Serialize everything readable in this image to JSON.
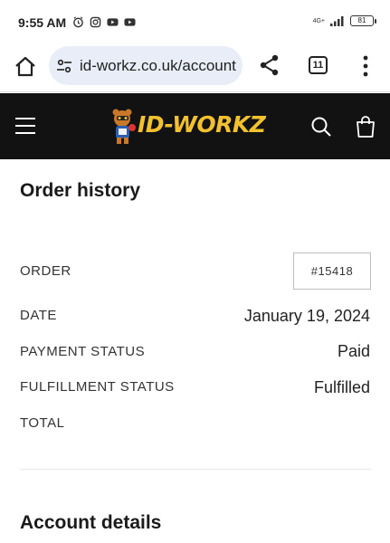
{
  "status_bar": {
    "time": "9:55 AM",
    "notification_icons": [
      "alarm-icon",
      "instagram-icon",
      "youtube-icon",
      "youtube-icon"
    ],
    "network_label": "4G+",
    "battery_level": "81"
  },
  "browser": {
    "url": "id-workz.co.uk/account",
    "tab_count": "11"
  },
  "site": {
    "logo_text": "ID-WORKZ",
    "brand_color": "#f2c12e",
    "header_bg": "#121212"
  },
  "page": {
    "title": "Order history",
    "order": {
      "order_label": "ORDER",
      "order_number": "#15418",
      "date_label": "DATE",
      "date_value": "January 19, 2024",
      "payment_label": "PAYMENT STATUS",
      "payment_value": "Paid",
      "fulfillment_label": "FULFILLMENT STATUS",
      "fulfillment_value": "Fulfilled",
      "total_label": "TOTAL"
    },
    "account_section_title": "Account details"
  }
}
